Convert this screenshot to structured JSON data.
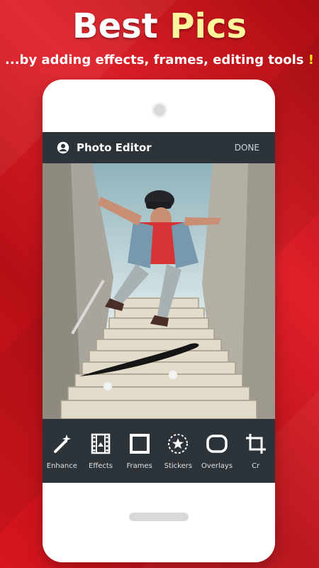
{
  "promo": {
    "headline_main": "Best",
    "headline_accent": "Pics",
    "subline": "...by adding effects, frames, editing tools",
    "subline_mark": "!"
  },
  "app": {
    "title": "Photo Editor",
    "done_label": "DONE",
    "tools": [
      {
        "label": "Enhance",
        "icon": "magic-wand-icon"
      },
      {
        "label": "Effects",
        "icon": "film-strip-icon"
      },
      {
        "label": "Frames",
        "icon": "square-frame-icon"
      },
      {
        "label": "Stickers",
        "icon": "star-sticker-icon"
      },
      {
        "label": "Overlays",
        "icon": "rounded-rect-icon"
      },
      {
        "label": "Cr",
        "icon": "crop-icon"
      }
    ]
  },
  "colors": {
    "background_red": "#d7151d",
    "dark_bar": "#2c343a",
    "accent_yellow": "#fff59d"
  }
}
